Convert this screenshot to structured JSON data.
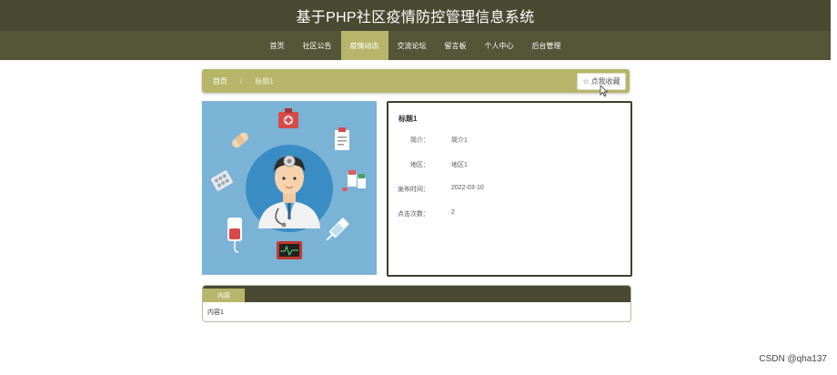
{
  "header": {
    "title": "基于PHP社区疫情防控管理信息系统"
  },
  "nav": {
    "items": [
      "首页",
      "社区公告",
      "疫情动态",
      "交流论坛",
      "留言板",
      "个人中心",
      "后台管理"
    ],
    "active": "疫情动态"
  },
  "breadcrumb": {
    "home": "首页",
    "separator": "/",
    "current": "标题1"
  },
  "favorite_button": {
    "label": "点我收藏"
  },
  "detail": {
    "title": "标题1",
    "fields": [
      {
        "label": "简介：",
        "value": "简介1"
      },
      {
        "label": "地区：",
        "value": "地区1"
      },
      {
        "label": "发布时间：",
        "value": "2022-03-10"
      },
      {
        "label": "点击次数：",
        "value": "2"
      }
    ]
  },
  "content": {
    "tab": "内容",
    "body": "内容1"
  },
  "watermark": "CSDN @qha137",
  "colors": {
    "header_bg": "#4a4a33",
    "nav_bg": "#555538",
    "accent": "#b7b56a",
    "image_bg": "#7bb3d6"
  }
}
